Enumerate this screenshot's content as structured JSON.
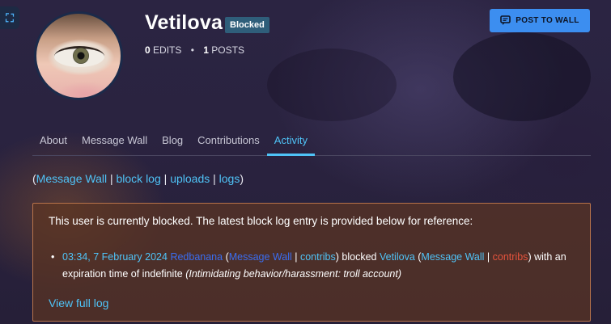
{
  "profile": {
    "username": "Vetilova",
    "badge": "Blocked",
    "edits_count": "0",
    "edits_label": "EDITS",
    "separator": "•",
    "posts_count": "1",
    "posts_label": "POSTS",
    "post_button_label": "POST TO WALL"
  },
  "tabs": [
    {
      "label": "About"
    },
    {
      "label": "Message Wall"
    },
    {
      "label": "Blog"
    },
    {
      "label": "Contributions"
    },
    {
      "label": "Activity",
      "active": true
    }
  ],
  "tool_links": {
    "open_paren": "(",
    "message_wall": "Message Wall",
    "block_log": "block log",
    "uploads": "uploads",
    "logs": "logs",
    "sep": "|",
    "close_paren": ")"
  },
  "block_notice": {
    "intro": "This user is currently blocked. The latest block log entry is provided below for reference:",
    "timestamp": "03:34, 7 February 2024",
    "admin": "Redbanana",
    "admin_wall": "Message Wall",
    "admin_contribs": "contribs",
    "action": "blocked",
    "target": "Vetilova",
    "target_wall": "Message Wall",
    "target_contribs": "contribs",
    "expiry_text": "with an expiration time of indefinite",
    "reason": "(Intimidating behavior/harassment: troll account)",
    "view_full_log": "View full log"
  },
  "icons": {
    "expand": "expand-icon",
    "post": "speech-bubble-icon"
  },
  "colors": {
    "accent": "#4fc3f7",
    "button": "#3c8ef0",
    "badge": "#2f5e7a",
    "notice_bg": "#5c3422",
    "notice_border": "#b8734a",
    "red_link": "#e5533c"
  }
}
